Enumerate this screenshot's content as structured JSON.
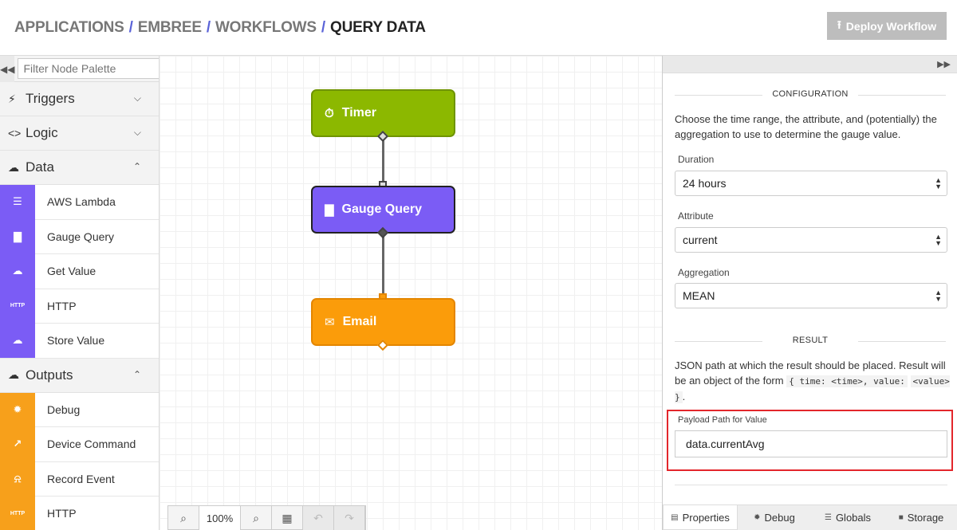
{
  "breadcrumb": {
    "items": [
      "APPLICATIONS",
      "EMBREE",
      "WORKFLOWS",
      "QUERY DATA"
    ],
    "separator": "/"
  },
  "header": {
    "deploy_label": "Deploy Workflow"
  },
  "palette": {
    "filter_placeholder": "Filter Node Palette",
    "categories": {
      "triggers": "Triggers",
      "logic": "Logic",
      "data": "Data",
      "outputs": "Outputs"
    },
    "data_nodes": [
      "AWS Lambda",
      "Gauge Query",
      "Get Value",
      "HTTP",
      "Store Value"
    ],
    "output_nodes": [
      "Debug",
      "Device Command",
      "Record Event",
      "HTTP"
    ],
    "http_badge": "HTTP"
  },
  "canvas": {
    "nodes": {
      "timer": "Timer",
      "gauge": "Gauge Query",
      "email": "Email"
    },
    "zoom": "100%"
  },
  "panel": {
    "config_header": "CONFIGURATION",
    "config_desc": "Choose the time range, the attribute, and (potentially) the aggregation to use to determine the gauge value.",
    "duration_label": "Duration",
    "duration_value": "24 hours",
    "attribute_label": "Attribute",
    "attribute_value": "current",
    "aggregation_label": "Aggregation",
    "aggregation_value": "MEAN",
    "result_header": "RESULT",
    "result_desc_1": "JSON path at which the result should be placed. Result will be an object of the form",
    "result_code_1": "{ time: <time>, value:",
    "result_code_2": "<value> }",
    "result_desc_end": ".",
    "payload_label": "Payload Path for Value",
    "payload_value": "data.currentAvg",
    "tabs": [
      "Properties",
      "Debug",
      "Globals",
      "Storage"
    ]
  },
  "colors": {
    "timer": "#8cb800",
    "gauge": "#7b5cf5",
    "email": "#fb9c0a",
    "highlight": "#e3262b",
    "deploy_disabled": "#bdbdbd"
  }
}
